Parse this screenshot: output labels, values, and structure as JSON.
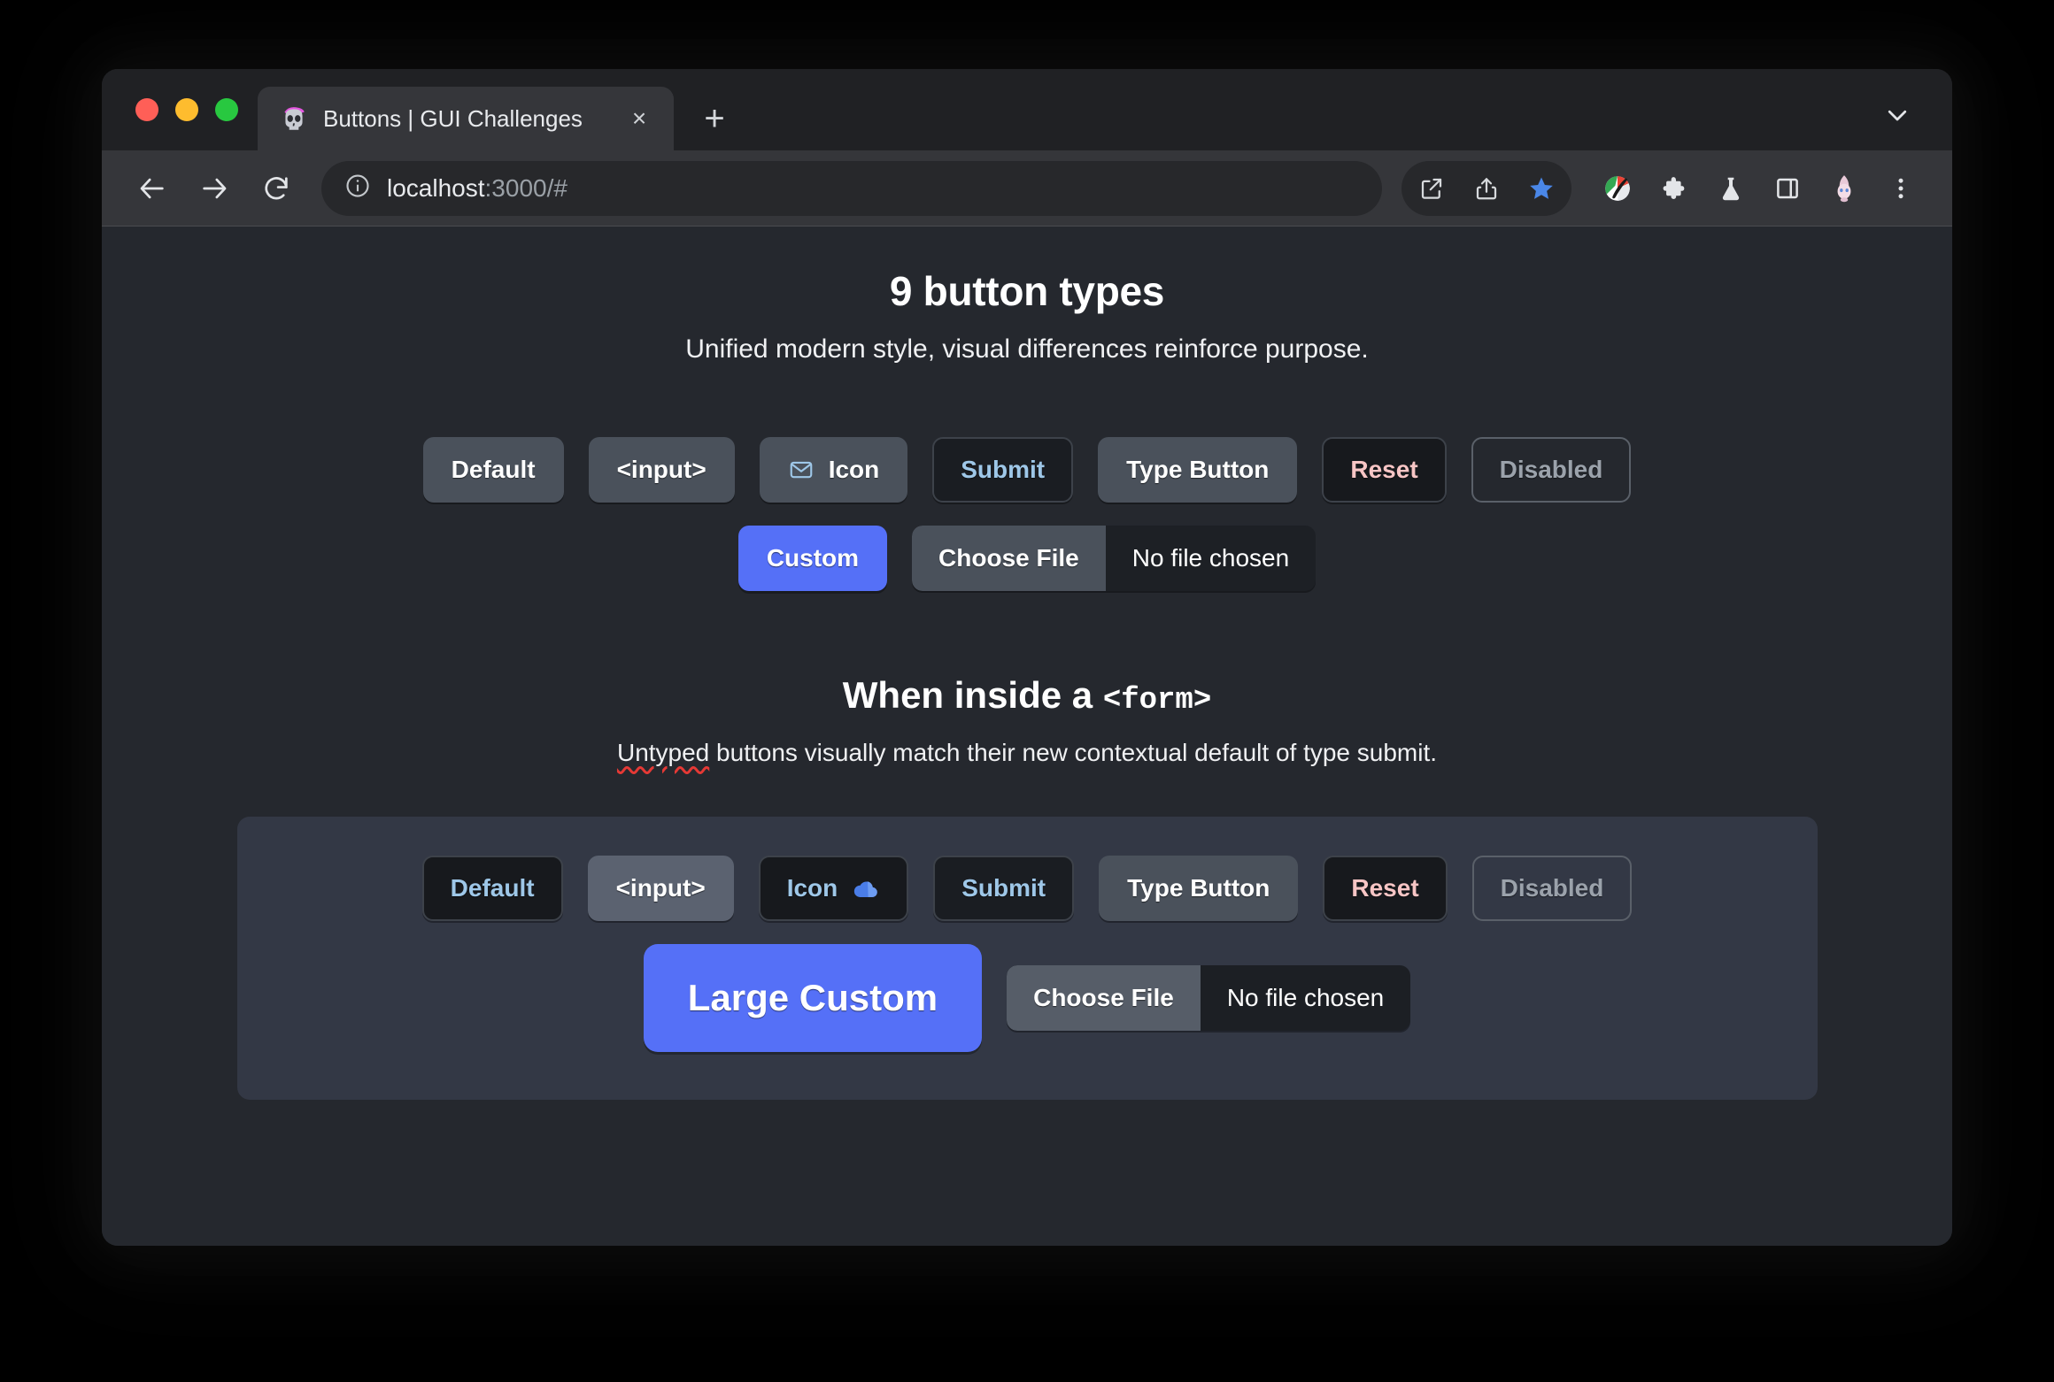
{
  "browser": {
    "traffic_lights": [
      "close",
      "minimize",
      "zoom"
    ],
    "tab": {
      "title": "Buttons | GUI Challenges",
      "favicon": "skull-favicon",
      "close_label": "×"
    },
    "new_tab_label": "+",
    "toolbar": {
      "back": "back-arrow-icon",
      "forward": "forward-arrow-icon",
      "reload": "reload-icon",
      "url_main": "localhost",
      "url_dim": ":3000/#",
      "site_info": "info-circle-icon",
      "actions": [
        "open-external-icon",
        "share-icon",
        "bookmark-star-icon"
      ],
      "extensions": [
        "color-palette-icon",
        "puzzle-piece-icon",
        "flask-icon",
        "side-panel-icon",
        "profile-avatar-icon"
      ],
      "menu": "three-dot-menu-icon"
    }
  },
  "page": {
    "title": "9 button types",
    "subtitle": "Unified modern style, visual differences reinforce purpose.",
    "buttons_row1": [
      {
        "label": "Default",
        "variant": "default"
      },
      {
        "label": "<input>",
        "variant": "default"
      },
      {
        "label": "Icon",
        "variant": "default",
        "icon": "envelope-icon"
      },
      {
        "label": "Submit",
        "variant": "submit"
      },
      {
        "label": "Type Button",
        "variant": "default"
      },
      {
        "label": "Reset",
        "variant": "reset"
      },
      {
        "label": "Disabled",
        "variant": "disabled"
      }
    ],
    "buttons_row2": {
      "custom_label": "Custom",
      "file": {
        "button_label": "Choose File",
        "status": "No file chosen"
      }
    },
    "section": {
      "title_prefix": "When inside a ",
      "title_code": "<form>",
      "subtitle_misspelled": "Untyped",
      "subtitle_rest": " buttons visually match their new contextual default of type submit.",
      "buttons_row1": [
        {
          "label": "Default",
          "variant": "form-default"
        },
        {
          "label": "<input>",
          "variant": "form-input"
        },
        {
          "label": "Icon",
          "variant": "form-icon",
          "icon": "cloud-icon"
        },
        {
          "label": "Submit",
          "variant": "submit"
        },
        {
          "label": "Type Button",
          "variant": "default"
        },
        {
          "label": "Reset",
          "variant": "reset"
        },
        {
          "label": "Disabled",
          "variant": "disabled"
        }
      ],
      "buttons_row2": {
        "custom_label": "Large Custom",
        "file": {
          "button_label": "Choose File",
          "status": "No file chosen"
        }
      }
    }
  },
  "colors": {
    "page_bg": "#25282e",
    "panel_bg": "#333845",
    "default_btn": "#4a515b",
    "accent_blue": "#5570f7",
    "submit_text": "#9ec7e8",
    "reset_text": "#f7c5c5",
    "disabled_text": "#9ba2ab"
  }
}
